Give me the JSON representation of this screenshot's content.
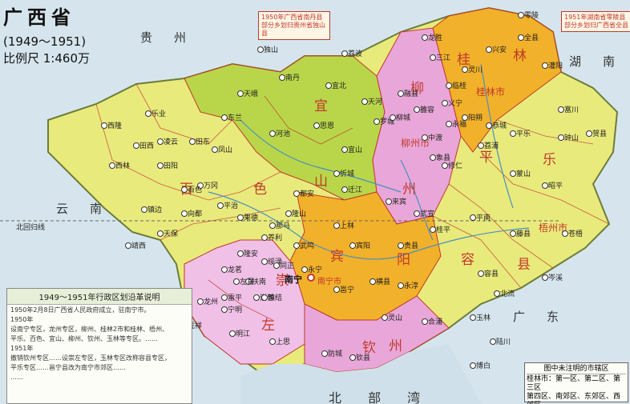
{
  "title": {
    "main": "广西省",
    "period": "(1949～1951)",
    "scale": "比例尺 1:460万"
  },
  "colors": {
    "yellow": "#e9ea7c",
    "green": "#b9d64a",
    "orange": "#f2b12a",
    "pink": "#e8a7d8",
    "palepink": "#f0c0e6",
    "water": "#cfe0ea",
    "border": "#c0392b"
  },
  "notes": {
    "n1": "1950年广西省南丹县部分乡划归贵州省独山县",
    "n2": "1951年湖南省零陵县部分乡划归广西省全县"
  },
  "neighbors": {
    "guizhou": "贵　州",
    "yunnan": "云　南",
    "hunan": "湖　南",
    "guangdong": "广　东",
    "beibu": "北 部 湾",
    "beihui": "北回归线"
  },
  "regions": {
    "yishan": [
      "宜",
      "山"
    ],
    "liuzhou": [
      "柳",
      "州"
    ],
    "guilin": [
      "桂",
      "林"
    ],
    "pingle": [
      "平",
      "乐"
    ],
    "baise": [
      "百",
      "色"
    ],
    "binyang": [
      "宾",
      "阳"
    ],
    "rongxian": [
      "容",
      "县"
    ],
    "chongzuo": [
      "崇",
      "左"
    ],
    "qinzhou": [
      "钦",
      "州"
    ],
    "wuzhou": "梧州市",
    "guilinshi": "桂林市",
    "liuzhoushi": "柳州市",
    "nanning": "南宁",
    "nanningshi": "南宁市"
  },
  "towns": [
    {
      "n": "南丹"
    },
    {
      "n": "天峨"
    },
    {
      "n": "东兰"
    },
    {
      "n": "凤山"
    },
    {
      "n": "河池"
    },
    {
      "n": "宜北"
    },
    {
      "n": "思恩"
    },
    {
      "n": "宜山"
    },
    {
      "n": "罗城"
    },
    {
      "n": "天河"
    },
    {
      "n": "融县"
    },
    {
      "n": "三江"
    },
    {
      "n": "龙胜"
    },
    {
      "n": "兴安"
    },
    {
      "n": "全县"
    },
    {
      "n": "灌阳"
    },
    {
      "n": "灵川"
    },
    {
      "n": "临桂"
    },
    {
      "n": "义宁"
    },
    {
      "n": "永福"
    },
    {
      "n": "阳朔"
    },
    {
      "n": "恭城"
    },
    {
      "n": "平乐"
    },
    {
      "n": "荔浦"
    },
    {
      "n": "蒙山"
    },
    {
      "n": "昭平"
    },
    {
      "n": "钟山"
    },
    {
      "n": "富川"
    },
    {
      "n": "贺县"
    },
    {
      "n": "苍梧"
    },
    {
      "n": "藤县"
    },
    {
      "n": "岑溪"
    },
    {
      "n": "容县"
    },
    {
      "n": "北流"
    },
    {
      "n": "玉林"
    },
    {
      "n": "陆川"
    },
    {
      "n": "博白"
    },
    {
      "n": "桂平"
    },
    {
      "n": "平南"
    },
    {
      "n": "贵县"
    },
    {
      "n": "横县"
    },
    {
      "n": "永淳"
    },
    {
      "n": "宾阳"
    },
    {
      "n": "上林"
    },
    {
      "n": "迁江"
    },
    {
      "n": "来宾"
    },
    {
      "n": "象县"
    },
    {
      "n": "武宣"
    },
    {
      "n": "修仁"
    },
    {
      "n": "中渡"
    },
    {
      "n": "雒容"
    },
    {
      "n": "柳城"
    },
    {
      "n": "忻城"
    },
    {
      "n": "都安"
    },
    {
      "n": "隆山"
    },
    {
      "n": "那马"
    },
    {
      "n": "武鸣"
    },
    {
      "n": "果德"
    },
    {
      "n": "隆安"
    },
    {
      "n": "平治"
    },
    {
      "n": "天保"
    },
    {
      "n": "镇边"
    },
    {
      "n": "靖西"
    },
    {
      "n": "向都"
    },
    {
      "n": "万冈"
    },
    {
      "n": "百色"
    },
    {
      "n": "田阳"
    },
    {
      "n": "田东"
    },
    {
      "n": "凌云"
    },
    {
      "n": "乐业"
    },
    {
      "n": "西林"
    },
    {
      "n": "西隆"
    },
    {
      "n": "田西"
    },
    {
      "n": "龙州"
    },
    {
      "n": "凭祥"
    },
    {
      "n": "宁明"
    },
    {
      "n": "明江"
    },
    {
      "n": "上思"
    },
    {
      "n": "扶南"
    },
    {
      "n": "绥渌"
    },
    {
      "n": "同正"
    },
    {
      "n": "崇善"
    },
    {
      "n": "左县"
    },
    {
      "n": "养利"
    },
    {
      "n": "龙茗"
    },
    {
      "n": "镇结"
    },
    {
      "n": "雷平"
    },
    {
      "n": "防城"
    },
    {
      "n": "钦县"
    },
    {
      "n": "灵山"
    },
    {
      "n": "合浦"
    },
    {
      "n": "邕宁"
    },
    {
      "n": "永宁"
    },
    {
      "n": "零陵"
    },
    {
      "n": "独山"
    },
    {
      "n": "荔波"
    }
  ],
  "textbox": {
    "header": "1949～1951年行政区划沿革说明",
    "lines": [
      "1950年2月8日广西省人民政府成立，驻南宁市。",
      "1950年",
      "设南宁专区，龙州专区，柳州、桂林2市和桂林、梧州、",
      "平乐、百色、宜山、柳州、钦州、玉林等专区。……",
      "1951年",
      "撤销钦州专区……设崇左专区，玉林专区改称容县专区，",
      "平乐专区……邕宁县改为南宁市郊区……",
      "……"
    ]
  },
  "legend": {
    "header": "图中未注明的市辖区",
    "lines": [
      "桂林市：第一区、第二区、第三区",
      "第四区、南郊区、东郊区、西郊区"
    ]
  }
}
